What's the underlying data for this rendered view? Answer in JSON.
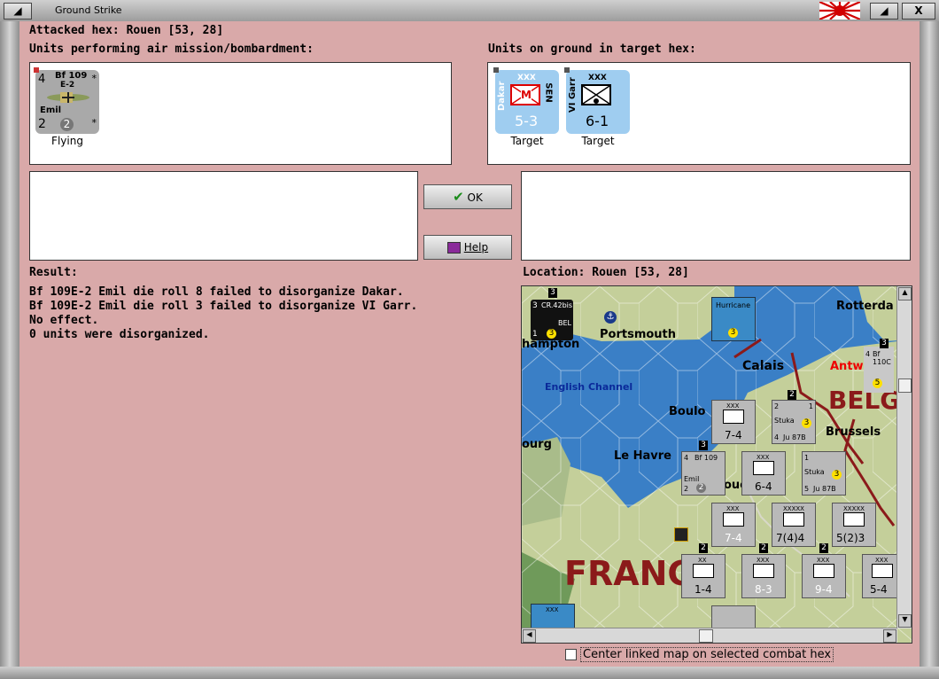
{
  "window": {
    "title": "Ground Strike",
    "close_glyph": "X"
  },
  "header": {
    "attacked_hex": "Attacked hex: Rouen  [53, 28]"
  },
  "air_panel": {
    "label": "Units performing air mission/bombardment:",
    "units": [
      {
        "name": "Bf 109",
        "variant": "E-2",
        "nickname": "Emil",
        "top_left": "4",
        "bottom_left": "2",
        "bottom_mid": "2",
        "status": "Flying"
      }
    ]
  },
  "ground_panel": {
    "label": "Units on ground in target hex:",
    "units": [
      {
        "name": "Dakar",
        "size": "XXX",
        "nation": "SEN",
        "symbol": "M",
        "strength": "5-3",
        "status": "Target"
      },
      {
        "name": "VI Garr",
        "size": "XXX",
        "strength": "6-1",
        "status": "Target"
      }
    ]
  },
  "buttons": {
    "ok": "OK",
    "help": "Help"
  },
  "result": {
    "label": "Result:",
    "lines": [
      "Bf 109E-2 Emil die roll 8 failed to disorganize Dakar.",
      "Bf 109E-2 Emil die roll 3 failed to disorganize VI Garr.",
      "No effect.",
      "0 units were disorganized."
    ]
  },
  "location": {
    "label": "Location:  Rouen  [53, 28]"
  },
  "map": {
    "places": {
      "rotterdam": "Rotterda",
      "portsmouth": "Portsmouth",
      "southampton": "hampton",
      "calais": "Calais",
      "antwerp": "Antw",
      "belgium": "BELG",
      "channel": "English Channel",
      "boulogne": "Boulo",
      "brussels": "Brussels",
      "cherbourg": "ourg",
      "lehavre": "Le Havre",
      "rouen": "oue",
      "france": "FRANC"
    },
    "counters": [
      {
        "id": "cr42",
        "name": "CR.42bis",
        "tag": "BEL",
        "a": "3",
        "b": "1",
        "c": "3",
        "stack": "3"
      },
      {
        "id": "hurricane",
        "name": "Hurricane",
        "c": "3"
      },
      {
        "id": "bf110",
        "name": "Bf 110C",
        "a": "4",
        "c": "5",
        "stack": "3"
      },
      {
        "id": "inf1",
        "size": "XXX",
        "strength": "7-4"
      },
      {
        "id": "stuka1",
        "name": "Stuka",
        "sub": "Ju 87B",
        "a": "2",
        "b": "1",
        "bottom": "4",
        "c": "3",
        "stack": "2"
      },
      {
        "id": "bf109map",
        "name": "Bf 109",
        "nick": "Emil",
        "a": "4",
        "b": "2",
        "c": "2",
        "stack": "3"
      },
      {
        "id": "inf2",
        "size": "XXX",
        "strength": "6-4"
      },
      {
        "id": "stuka2",
        "name": "Stuka",
        "sub": "Ju 87B",
        "a": "1",
        "bottom": "5",
        "c": "3"
      },
      {
        "id": "inf3",
        "size": "XXX",
        "strength": "7-4"
      },
      {
        "id": "arm1",
        "size": "XXXXX",
        "strength": "7(4)4"
      },
      {
        "id": "arm2",
        "size": "XXXXX",
        "strength": "5(2)3"
      },
      {
        "id": "inf4",
        "size": "XX",
        "strength": "1-4",
        "stack": "2"
      },
      {
        "id": "inf5",
        "size": "XXX",
        "strength": "8-3",
        "stack": "2"
      },
      {
        "id": "inf6",
        "size": "XXX",
        "strength": "9-4",
        "stack": "2"
      },
      {
        "id": "inf7",
        "size": "XXX",
        "strength": "5-4"
      },
      {
        "id": "bottomblue",
        "size": "XXX"
      }
    ]
  },
  "checkbox": {
    "label": "Center linked map on selected combat hex",
    "checked": false
  },
  "colors": {
    "background": "#d9a9a9",
    "sea": "#3a7fc6",
    "land": "#c4cf9a",
    "border": "#8b1a1a"
  }
}
